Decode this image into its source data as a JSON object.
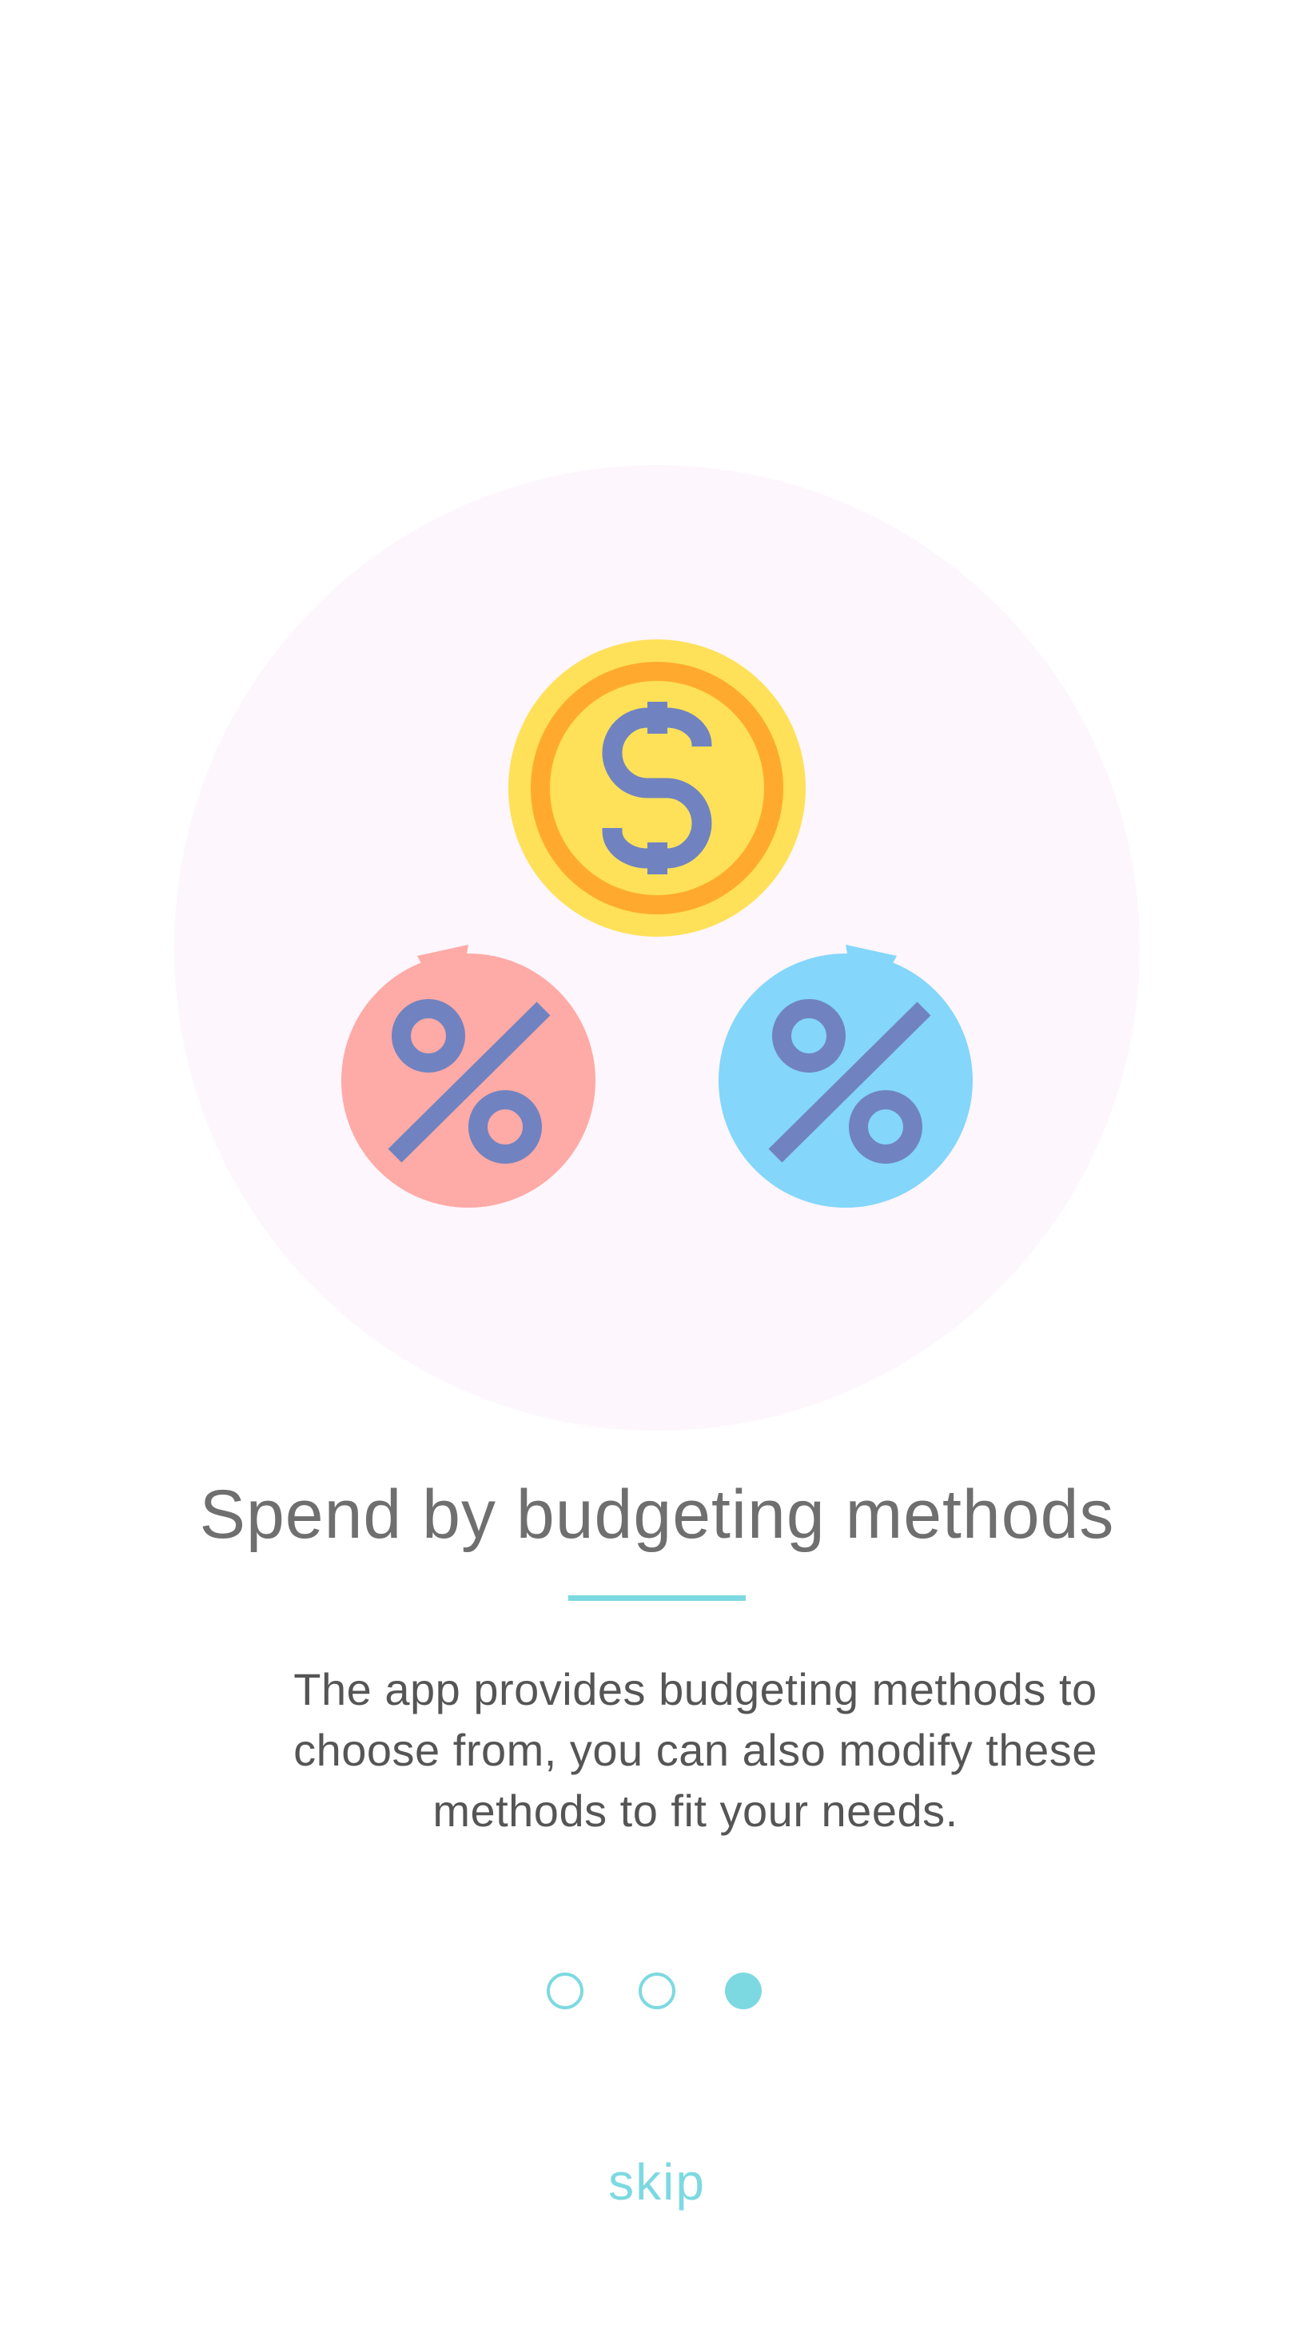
{
  "colors": {
    "hero_background": "#fdf6fc",
    "coin_outer": "#fee158",
    "coin_ring": "#ffaa2e",
    "coin_inner": "#fee158",
    "symbol": "#7083c0",
    "bubble_left": "#feaaa6",
    "bubble_right": "#84d6fb",
    "accent": "#7dd9e1",
    "title_text": "#6f6f6f",
    "body_text": "#555555"
  },
  "illustration": {
    "icons": [
      "dollar-coin-icon",
      "percent-bubble-icon",
      "percent-bubble-icon"
    ]
  },
  "onboarding": {
    "title": "Spend by budgeting methods",
    "description": "The app provides budgeting methods to choose from, you can also modify these methods to fit your needs.",
    "pagination": {
      "total": 3,
      "active_index": 2
    },
    "skip_label": "skip"
  }
}
